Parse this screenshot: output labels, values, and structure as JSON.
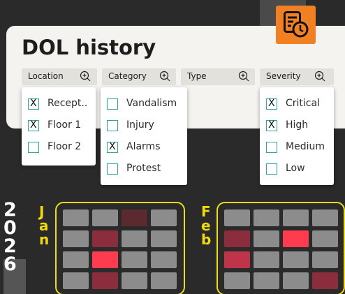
{
  "title": "DOL history",
  "header_button": {
    "icon": "history-icon",
    "color": "#f08022"
  },
  "filters": [
    {
      "label": "Location",
      "options": [
        {
          "label": "Recept..",
          "checked": true
        },
        {
          "label": "Floor 1",
          "checked": true
        },
        {
          "label": "Floor 2",
          "checked": false
        }
      ]
    },
    {
      "label": "Category",
      "options": [
        {
          "label": "Vandalism",
          "checked": false
        },
        {
          "label": "Injury",
          "checked": false
        },
        {
          "label": "Alarms",
          "checked": true
        },
        {
          "label": "Protest",
          "checked": false
        }
      ]
    },
    {
      "label": "Type",
      "options": []
    },
    {
      "label": "Severity",
      "options": [
        {
          "label": "Critical",
          "checked": true
        },
        {
          "label": "High",
          "checked": true
        },
        {
          "label": "Medium",
          "checked": false
        },
        {
          "label": "Low",
          "checked": false
        }
      ]
    }
  ],
  "year_digits": [
    "2",
    "0",
    "2",
    "6"
  ],
  "months": [
    {
      "letters": [
        "J",
        "a",
        "n"
      ],
      "cells": [
        [
          "#8c8c8c",
          "#8c8c8c",
          "#5a2a30",
          "#8c8c8c"
        ],
        [
          "#8c8c8c",
          "#8c2d3e",
          "#8c8c8c",
          "#8c8c8c"
        ],
        [
          "#8c8c8c",
          "#ff3b4f",
          "#8c8c8c",
          "#8c8c8c"
        ],
        [
          "#8c8c8c",
          "#8c2d3e",
          "#8c8c8c",
          "#8c8c8c"
        ]
      ]
    },
    {
      "letters": [
        "F",
        "e",
        "b"
      ],
      "cells": [
        [
          "#8c8c8c",
          "#8c8c8c",
          "#8c8c8c",
          "#8c8c8c"
        ],
        [
          "#8c2d3e",
          "#8c8c8c",
          "#ff3b4f",
          "#8c8c8c"
        ],
        [
          "#c0344a",
          "#8c8c8c",
          "#8c8c8c",
          "#8c8c8c"
        ],
        [
          "#8c8c8c",
          "#8c8c8c",
          "#8c8c8c",
          "#8c2d3e"
        ]
      ]
    }
  ],
  "colors": {
    "accent": "#f08022",
    "calendar_border": "#eddc1b",
    "checkbox": "#2aa6a0"
  }
}
